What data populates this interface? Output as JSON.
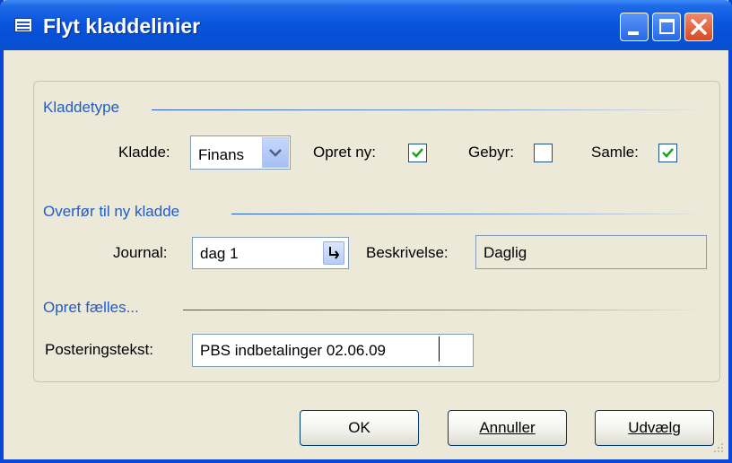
{
  "window": {
    "title": "Flyt kladdelinier",
    "controls": {
      "minimize": "minimize-icon",
      "maximize": "maximize-icon",
      "close": "close-icon"
    }
  },
  "groups": {
    "kladdetype": "Kladdetype",
    "overfor": "Overfør til ny kladde",
    "opret_faelles": "Opret fælles..."
  },
  "kladdetype": {
    "kladde_label": "Kladde:",
    "kladde_value": "Finans",
    "opret_ny_label": "Opret ny:",
    "opret_ny_checked": true,
    "gebyr_label": "Gebyr:",
    "gebyr_checked": false,
    "samle_label": "Samle:",
    "samle_checked": true
  },
  "overfor": {
    "journal_label": "Journal:",
    "journal_value": "dag 1",
    "beskrivelse_label": "Beskrivelse:",
    "beskrivelse_value": "Daglig"
  },
  "opret_faelles": {
    "posteringstekst_label": "Posteringstekst:",
    "posteringstekst_value": "PBS indbetalinger 02.06.09"
  },
  "buttons": {
    "ok": "OK",
    "annuller": "Annuller",
    "udvaelg": "Udvælg"
  },
  "colors": {
    "titlebar": "#0a55dc",
    "group_label": "#215dc6",
    "dialog_bg": "#ece9d8",
    "check_mark": "#21a121"
  }
}
